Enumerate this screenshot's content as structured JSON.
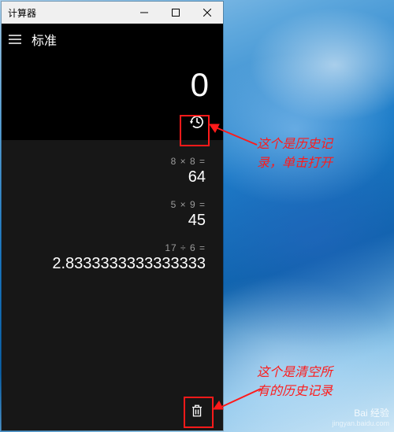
{
  "window": {
    "title": "计算器"
  },
  "mode": {
    "label": "标准"
  },
  "display": {
    "value": "0"
  },
  "history": {
    "items": [
      {
        "expr": "8  ×  8 =",
        "result": "64"
      },
      {
        "expr": "5  ×  9 =",
        "result": "45"
      },
      {
        "expr": "17  ÷  6 =",
        "result": "2.8333333333333333"
      }
    ]
  },
  "annotations": {
    "a1_line1": "这个是历史记",
    "a1_line2": "录，单击打开",
    "a2_line1": "这个是清空所",
    "a2_line2": "有的历史记录"
  },
  "watermark": {
    "brand": "Bai",
    "brand2": "经验",
    "sub": "jingyan.baidu.com"
  },
  "icons": {
    "minimize": "minimize-icon",
    "maximize": "maximize-icon",
    "close": "close-icon",
    "hamburger": "hamburger-icon",
    "history": "history-icon",
    "trash": "trash-icon"
  }
}
